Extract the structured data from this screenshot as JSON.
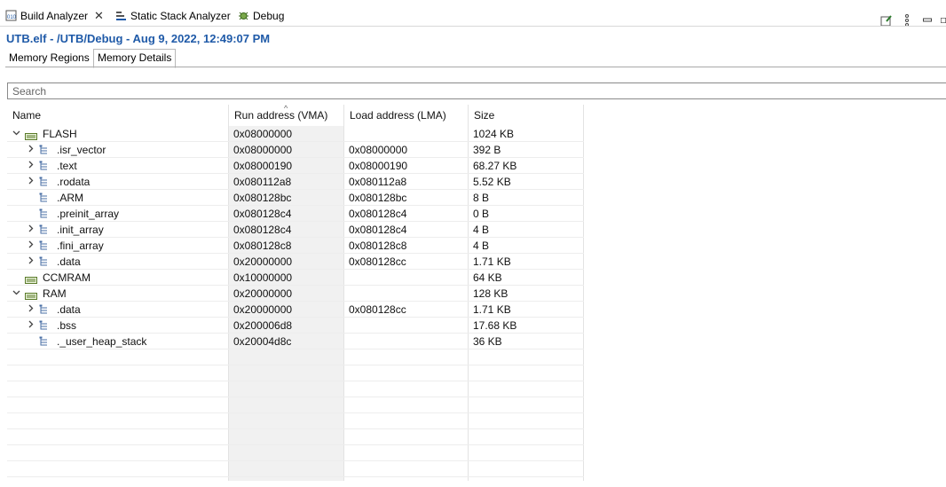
{
  "view_tabs": [
    {
      "label": "Build Analyzer",
      "active": true
    },
    {
      "label": "Static Stack Analyzer",
      "active": false
    },
    {
      "label": "Debug",
      "active": false
    }
  ],
  "title": "UTB.elf - /UTB/Debug - Aug 9, 2022, 12:49:07 PM",
  "sub_tabs": [
    {
      "label": "Memory Regions",
      "selected": false
    },
    {
      "label": "Memory Details",
      "selected": true
    }
  ],
  "search": {
    "placeholder": "Search",
    "value": ""
  },
  "columns": [
    "Name",
    "Run address (VMA)",
    "Load address (LMA)",
    "Size"
  ],
  "rows": [
    {
      "kind": "region",
      "name": "FLASH",
      "expanded": true,
      "vma": "0x08000000",
      "lma": "",
      "size": "1024 KB"
    },
    {
      "kind": "section",
      "name": ".isr_vector",
      "expandable": true,
      "vma": "0x08000000",
      "lma": "0x08000000",
      "size": "392 B"
    },
    {
      "kind": "section",
      "name": ".text",
      "expandable": true,
      "vma": "0x08000190",
      "lma": "0x08000190",
      "size": "68.27 KB"
    },
    {
      "kind": "section",
      "name": ".rodata",
      "expandable": true,
      "vma": "0x080112a8",
      "lma": "0x080112a8",
      "size": "5.52 KB"
    },
    {
      "kind": "section",
      "name": ".ARM",
      "expandable": false,
      "vma": "0x080128bc",
      "lma": "0x080128bc",
      "size": "8 B"
    },
    {
      "kind": "section",
      "name": ".preinit_array",
      "expandable": false,
      "vma": "0x080128c4",
      "lma": "0x080128c4",
      "size": "0 B"
    },
    {
      "kind": "section",
      "name": ".init_array",
      "expandable": true,
      "vma": "0x080128c4",
      "lma": "0x080128c4",
      "size": "4 B"
    },
    {
      "kind": "section",
      "name": ".fini_array",
      "expandable": true,
      "vma": "0x080128c8",
      "lma": "0x080128c8",
      "size": "4 B"
    },
    {
      "kind": "section",
      "name": ".data",
      "expandable": true,
      "vma": "0x20000000",
      "lma": "0x080128cc",
      "size": "1.71 KB"
    },
    {
      "kind": "region",
      "name": "CCMRAM",
      "expanded": false,
      "noexpand": true,
      "vma": "0x10000000",
      "lma": "",
      "size": "64 KB"
    },
    {
      "kind": "region",
      "name": "RAM",
      "expanded": true,
      "vma": "0x20000000",
      "lma": "",
      "size": "128 KB"
    },
    {
      "kind": "section",
      "name": ".data",
      "expandable": true,
      "vma": "0x20000000",
      "lma": "0x080128cc",
      "size": "1.71 KB"
    },
    {
      "kind": "section",
      "name": ".bss",
      "expandable": true,
      "vma": "0x200006d8",
      "lma": "",
      "size": "17.68 KB"
    },
    {
      "kind": "section",
      "name": "._user_heap_stack",
      "expandable": false,
      "vma": "0x20004d8c",
      "lma": "",
      "size": "36 KB"
    }
  ],
  "colors": {
    "title": "#1f5aa8",
    "accent": "#2a7a2a"
  }
}
